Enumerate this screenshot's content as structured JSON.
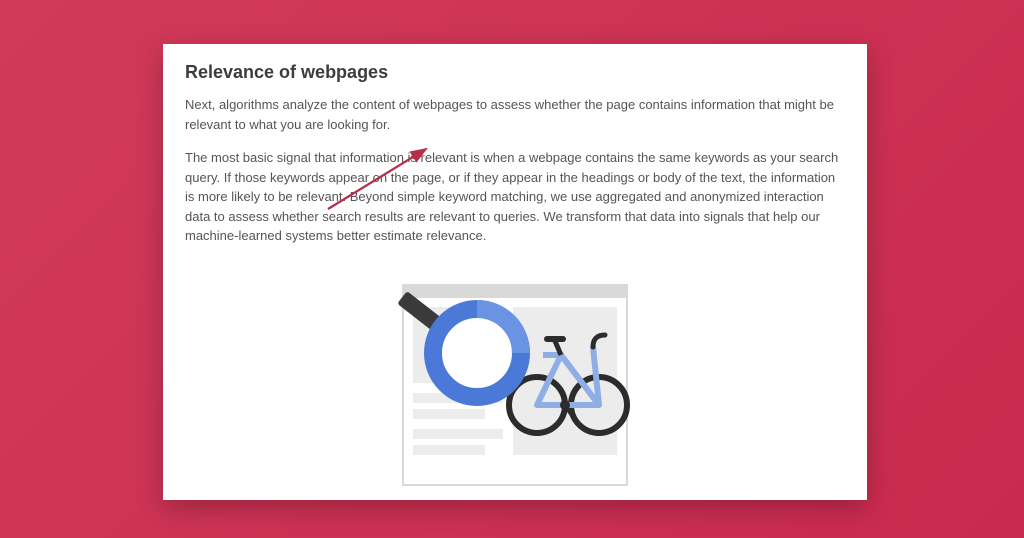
{
  "heading": "Relevance of webpages",
  "paragraph1": "Next, algorithms analyze the content of webpages to assess whether the page contains information that might be relevant to what you are looking for.",
  "paragraph2": "The most basic signal that information is relevant is when a webpage contains the same keywords as your search query. If those keywords appear on the page, or if they appear in the headings or body of the text, the information is more likely to be relevant. Beyond simple keyword matching, we use aggregated and anonymized interaction data to assess whether search results are relevant to queries. We transform that data into signals that help our machine-learned systems better estimate relevance."
}
